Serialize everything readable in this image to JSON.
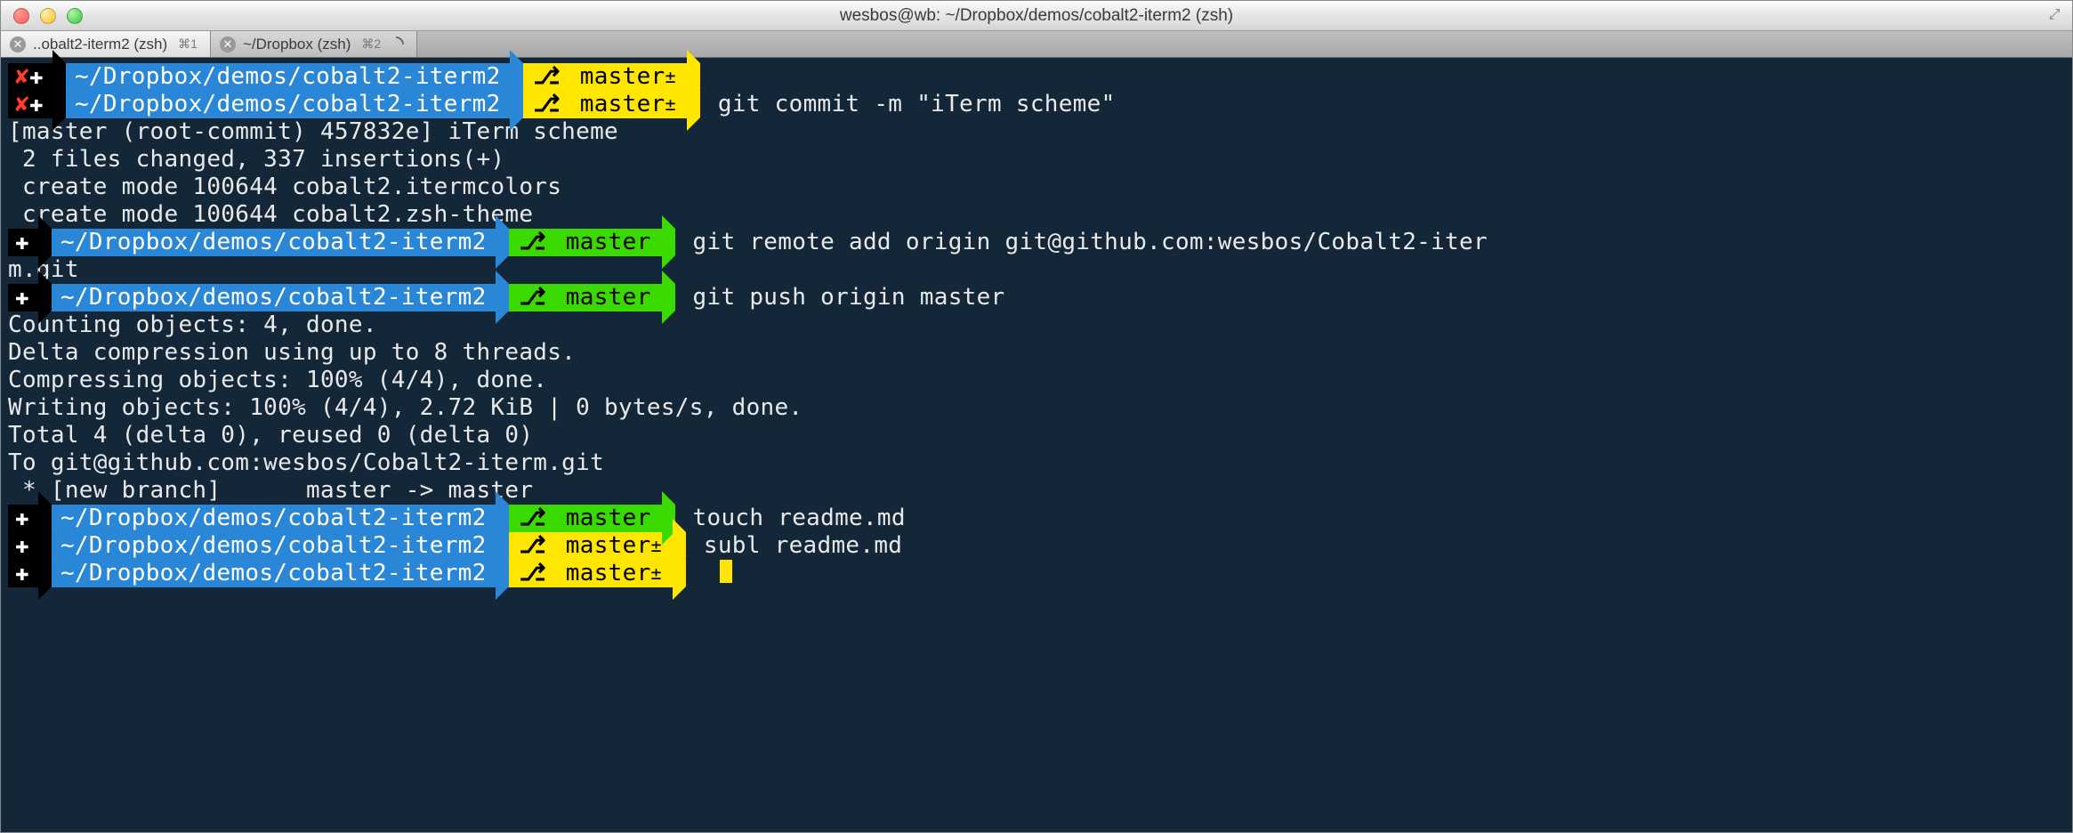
{
  "window": {
    "title": "wesbos@wb: ~/Dropbox/demos/cobalt2-iterm2 (zsh)"
  },
  "tabs": [
    {
      "label": "..obalt2-iterm2 (zsh)",
      "shortcut": "⌘1",
      "active": true,
      "spinner": false
    },
    {
      "label": "~/Dropbox (zsh)",
      "shortcut": "⌘2",
      "active": false,
      "spinner": true
    }
  ],
  "glyphs": {
    "x": "✘",
    "plus": "✚",
    "branch": "⎇"
  },
  "prompts": [
    {
      "status": "dirty-x",
      "path": "~/Dropbox/demos/cobalt2-iterm2",
      "branch": "master",
      "branch_state": "dirty",
      "branch_color": "yellow",
      "command": ""
    },
    {
      "status": "dirty-x",
      "path": "~/Dropbox/demos/cobalt2-iterm2",
      "branch": "master",
      "branch_state": "dirty",
      "branch_color": "yellow",
      "command": "git commit -m \"iTerm scheme\""
    }
  ],
  "output1": [
    "",
    "[master (root-commit) 457832e] iTerm scheme",
    " 2 files changed, 337 insertions(+)",
    " create mode 100644 cobalt2.itermcolors",
    " create mode 100644 cobalt2.zsh-theme"
  ],
  "prompt_remote": {
    "status": "plus",
    "path": "~/Dropbox/demos/cobalt2-iterm2",
    "branch": "master",
    "branch_state": "clean",
    "branch_color": "green",
    "command_part1": "git remote add origin git@github.com:wesbos/Cobalt2-iter",
    "command_wrap": "m.git"
  },
  "prompt_push": {
    "status": "plus",
    "path": "~/Dropbox/demos/cobalt2-iterm2",
    "branch": "master",
    "branch_state": "clean",
    "branch_color": "green",
    "command": "git push origin master"
  },
  "output2": [
    "Counting objects: 4, done.",
    "Delta compression using up to 8 threads.",
    "Compressing objects: 100% (4/4), done.",
    "Writing objects: 100% (4/4), 2.72 KiB | 0 bytes/s, done.",
    "Total 4 (delta 0), reused 0 (delta 0)",
    "To git@github.com:wesbos/Cobalt2-iterm.git",
    " * [new branch]      master -> master"
  ],
  "prompts_tail": [
    {
      "status": "plus",
      "path": "~/Dropbox/demos/cobalt2-iterm2",
      "branch": "master",
      "branch_state": "clean",
      "branch_color": "green",
      "command": "touch readme.md"
    },
    {
      "status": "plus",
      "path": "~/Dropbox/demos/cobalt2-iterm2",
      "branch": "master",
      "branch_state": "dirty",
      "branch_color": "yellow",
      "command": "subl readme.md"
    },
    {
      "status": "plus",
      "path": "~/Dropbox/demos/cobalt2-iterm2",
      "branch": "master",
      "branch_state": "dirty",
      "branch_color": "yellow",
      "command": "",
      "cursor": true
    }
  ],
  "colors": {
    "bg": "#132738",
    "blue": "#2a87d7",
    "yellow": "#ffe600",
    "green": "#3ad900",
    "text": "#e9e9e9",
    "red": "#ff3b30"
  }
}
